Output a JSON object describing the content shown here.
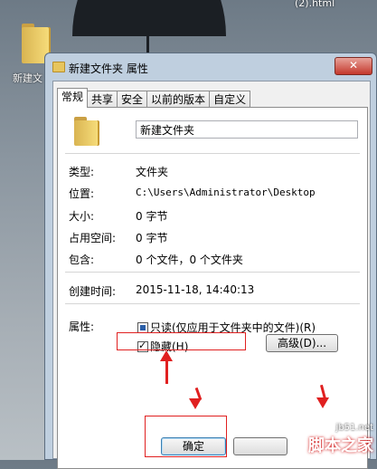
{
  "desktop": {
    "html_file_label": "(2).html",
    "folder_label": "新建文"
  },
  "dialog": {
    "title": "新建文件夹 属性",
    "close_symbol": "✕",
    "tabs": [
      {
        "label": "常规",
        "active": true
      },
      {
        "label": "共享",
        "active": false
      },
      {
        "label": "安全",
        "active": false
      },
      {
        "label": "以前的版本",
        "active": false
      },
      {
        "label": "自定义",
        "active": false
      }
    ],
    "name_value": "新建文件夹",
    "rows": {
      "type": {
        "label": "类型:",
        "value": "文件夹"
      },
      "location": {
        "label": "位置:",
        "value": "C:\\Users\\Administrator\\Desktop"
      },
      "size": {
        "label": "大小:",
        "value": "0 字节"
      },
      "size_on_disk": {
        "label": "占用空间:",
        "value": "0 字节"
      },
      "contains": {
        "label": "包含:",
        "value": "0 个文件，0 个文件夹"
      },
      "created": {
        "label": "创建时间:",
        "value": "2015-11-18, 14:40:13"
      }
    },
    "attributes": {
      "label": "属性:",
      "readonly_label": "只读(仅应用于文件夹中的文件)(R)",
      "readonly_state": "indeterminate",
      "hidden_label": "隐藏(H)",
      "hidden_checked": true,
      "advanced_button": "高级(D)..."
    },
    "buttons": {
      "ok": "确定"
    }
  },
  "annotation_color": "#e02020",
  "watermark": {
    "site": "jb51.net",
    "name": "脚本之家"
  }
}
